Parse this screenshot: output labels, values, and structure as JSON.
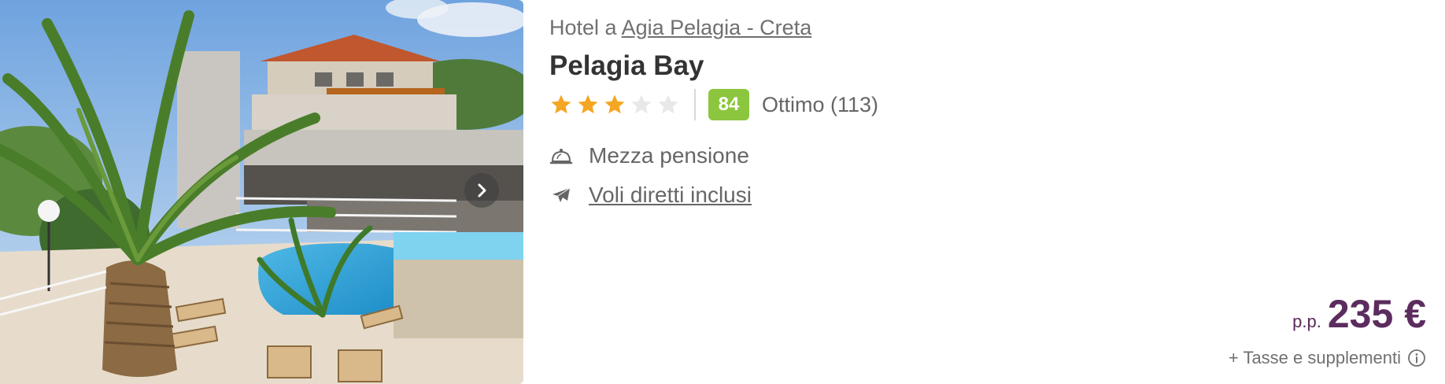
{
  "hotel": {
    "location_prefix": "Hotel a",
    "location_link": "Agia Pelagia - Creta",
    "name": "Pelagia Bay",
    "stars_filled": 3,
    "stars_total": 5,
    "score": "84",
    "review_label": "Ottimo (113)"
  },
  "features": {
    "board": "Mezza pensione",
    "flights": "Voli diretti inclusi"
  },
  "price": {
    "pp_label": "p.p.",
    "amount": "235 €",
    "taxes": "+ Tasse e supplementi"
  },
  "colors": {
    "star_filled": "#f5a623",
    "star_empty": "#e8e8e8",
    "score_badge": "#8cc63f",
    "price": "#5c2c5e"
  },
  "icons": {
    "board": "cloche-icon",
    "flights": "airplane-icon",
    "next": "chevron-right-icon",
    "info": "info-icon"
  }
}
